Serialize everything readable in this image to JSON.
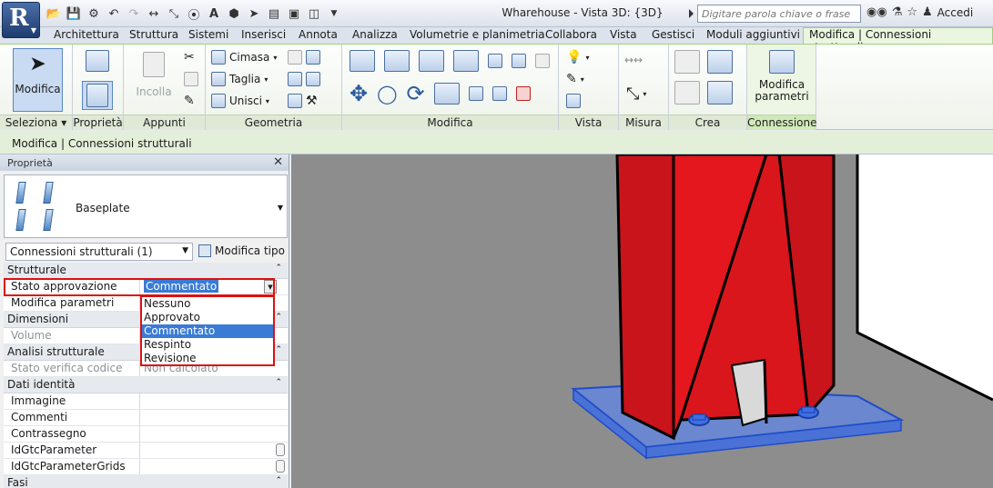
{
  "window": {
    "title": "Wharehouse - Vista 3D: {3D}",
    "search_placeholder": "Digitare parola chiave o frase",
    "sign_in": "Accedi"
  },
  "tabs": [
    {
      "label": "Architettura"
    },
    {
      "label": "Struttura"
    },
    {
      "label": "Sistemi"
    },
    {
      "label": "Inserisci"
    },
    {
      "label": "Annota"
    },
    {
      "label": "Analizza"
    },
    {
      "label": "Volumetrie e planimetria"
    },
    {
      "label": "Collabora"
    },
    {
      "label": "Vista"
    },
    {
      "label": "Gestisci"
    },
    {
      "label": "Moduli aggiuntivi"
    },
    {
      "label": "Modifica | Connessioni strutturali",
      "active": true
    }
  ],
  "ribbon": {
    "modifica": "Modifica",
    "incolla": "Incolla",
    "cimasa": "Cimasa",
    "taglia": "Taglia",
    "unisci": "Unisci",
    "modifica_parametri": "Modifica parametri",
    "panels": {
      "seleziona": "Seleziona",
      "proprieta": "Proprietà",
      "appunti": "Appunti",
      "geometria": "Geometria",
      "modifica": "Modifica",
      "vista": "Vista",
      "misura": "Misura",
      "crea": "Crea",
      "connessione": "Connessione"
    }
  },
  "context_bar": "Modifica | Connessioni strutturali",
  "properties": {
    "title": "Proprietà",
    "type_name": "Baseplate",
    "filter": "Connessioni strutturali (1)",
    "edit_type": "Modifica tipo",
    "groups": {
      "strutturale": "Strutturale",
      "dimensioni": "Dimensioni",
      "analisi": "Analisi strutturale",
      "identita": "Dati identità",
      "fasi": "Fasi"
    },
    "rows": {
      "stato_approvazione": "Stato approvazione",
      "stato_approvazione_value": "Commentato",
      "modifica_parametri": "Modifica parametri",
      "volume": "Volume",
      "stato_verifica": "Stato verifica codice",
      "stato_verifica_value": "Non calcolato",
      "immagine": "Immagine",
      "commenti": "Commenti",
      "contrassegno": "Contrassegno",
      "id_param": "IdGtcParameter",
      "id_param_grids": "IdGtcParameterGrids"
    },
    "dropdown_options": [
      "Nessuno",
      "Approvato",
      "Commentato",
      "Respinto",
      "Revisione"
    ],
    "selected_option": "Commentato"
  }
}
